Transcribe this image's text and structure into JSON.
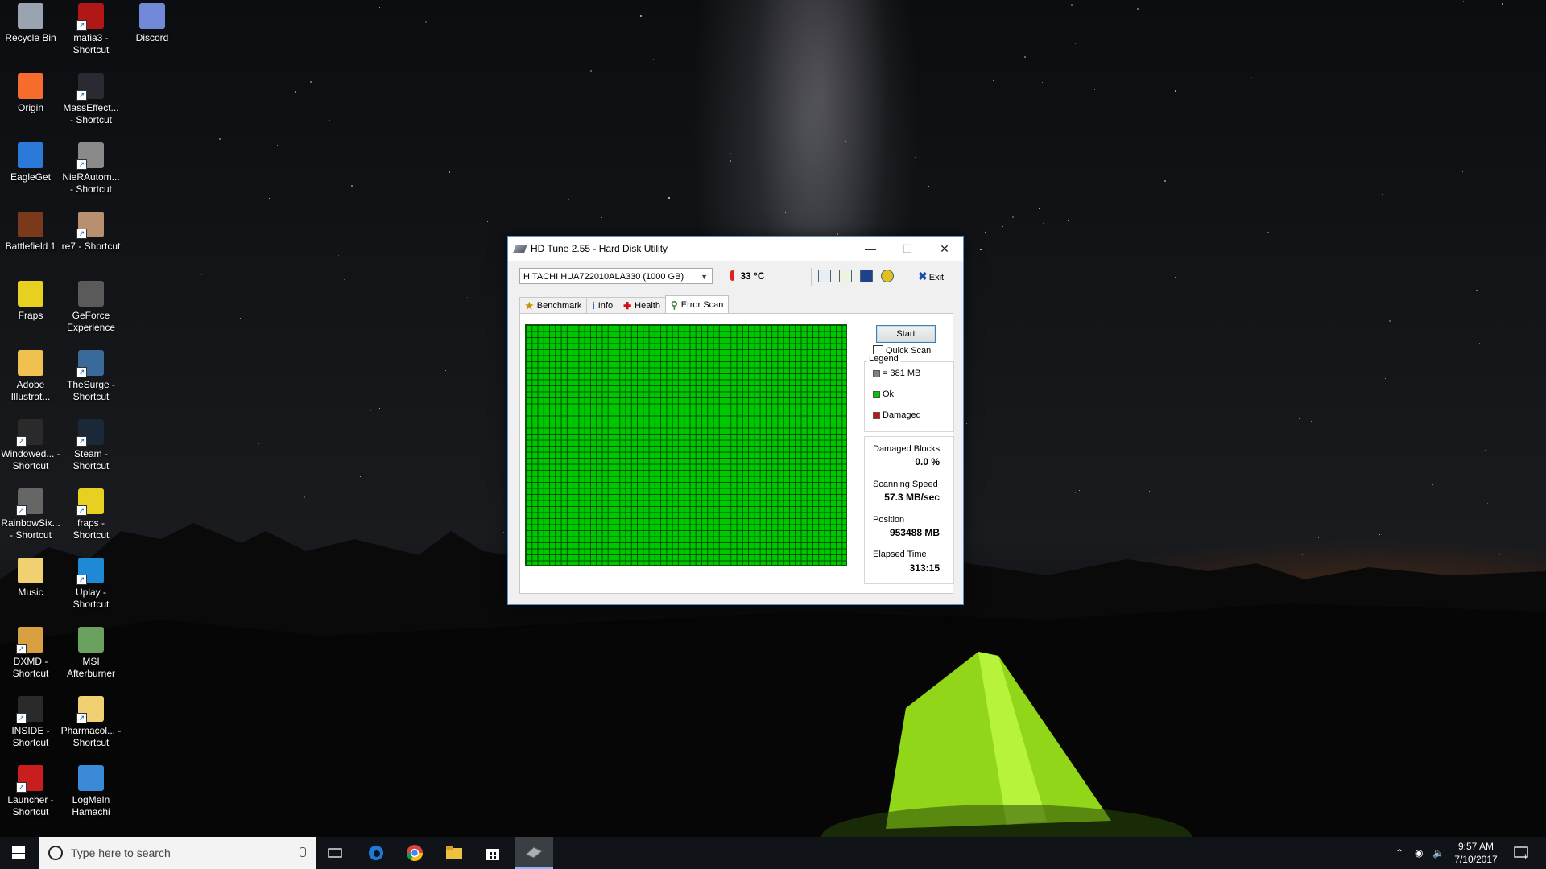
{
  "desktop_icons": [
    {
      "label": "Recycle Bin",
      "icon": "recycle-bin-icon",
      "color": "#9aa4b0"
    },
    {
      "label": "mafia3 - Shortcut",
      "icon": "mafia3-icon",
      "color": "#b01818"
    },
    {
      "label": "Discord",
      "icon": "discord-icon",
      "color": "#7289da"
    },
    {
      "label": "Origin",
      "icon": "origin-icon",
      "color": "#f56c2d"
    },
    {
      "label": "MassEffect... - Shortcut",
      "icon": "masseffect-icon",
      "color": "#2a2a32"
    },
    {
      "label": "EagleGet",
      "icon": "eagleget-icon",
      "color": "#2b79d8"
    },
    {
      "label": "NieRAutom... - Shortcut",
      "icon": "nier-icon",
      "color": "#8a8a8a"
    },
    {
      "label": "Battlefield 1",
      "icon": "battlefield-icon",
      "color": "#7a3a1a"
    },
    {
      "label": "re7 - Shortcut",
      "icon": "re7-icon",
      "color": "#b89070"
    },
    {
      "label": "Fraps",
      "icon": "fraps-icon",
      "color": "#e8d020"
    },
    {
      "label": "GeForce Experience",
      "icon": "geforce-icon",
      "color": "#5a5a5a"
    },
    {
      "label": "Adobe Illustrat...",
      "icon": "illustrator-icon",
      "color": "#f0c050"
    },
    {
      "label": "TheSurge - Shortcut",
      "icon": "thesurge-icon",
      "color": "#3a6a9a"
    },
    {
      "label": "Windowed... - Shortcut",
      "icon": "windowed-icon",
      "color": "#2a2a2a"
    },
    {
      "label": "Steam - Shortcut",
      "icon": "steam-icon",
      "color": "#1b2838"
    },
    {
      "label": "RainbowSix... - Shortcut",
      "icon": "rainbowsix-icon",
      "color": "#666666"
    },
    {
      "label": "fraps - Shortcut",
      "icon": "fraps-shortcut-icon",
      "color": "#e8d020"
    },
    {
      "label": "Music",
      "icon": "music-folder-icon",
      "color": "#f0d070"
    },
    {
      "label": "Uplay - Shortcut",
      "icon": "uplay-icon",
      "color": "#1e8ad6"
    },
    {
      "label": "DXMD - Shortcut",
      "icon": "dxmd-icon",
      "color": "#d8a040"
    },
    {
      "label": "MSI Afterburner",
      "icon": "afterburner-icon",
      "color": "#6aa060"
    },
    {
      "label": "INSIDE - Shortcut",
      "icon": "inside-icon",
      "color": "#2a2a2a"
    },
    {
      "label": "Pharmacol... - Shortcut",
      "icon": "folder-icon",
      "color": "#f0d070"
    },
    {
      "label": "Launcher - Shortcut",
      "icon": "hitman-launcher-icon",
      "color": "#c81e1e"
    },
    {
      "label": "LogMeIn Hamachi",
      "icon": "hamachi-icon",
      "color": "#3a8ad8"
    }
  ],
  "window": {
    "title": "HD Tune 2.55 - Hard Disk Utility",
    "drive_select": "HITACHI HUA722010ALA330 (1000 GB)",
    "temperature": "33 °C",
    "exit_label": "Exit",
    "tabs": [
      {
        "label": "Benchmark",
        "icon": "benchmark-icon"
      },
      {
        "label": "Info",
        "icon": "info-icon"
      },
      {
        "label": "Health",
        "icon": "health-icon"
      },
      {
        "label": "Error Scan",
        "icon": "error-scan-icon"
      }
    ],
    "active_tab": "Error Scan",
    "start_button": "Start",
    "quick_scan_label": "Quick Scan",
    "quick_scan_checked": false,
    "legend_title": "Legend",
    "legend": [
      {
        "label": "= 381 MB",
        "color": "#808080"
      },
      {
        "label": "Ok",
        "color": "#00c800"
      },
      {
        "label": "Damaged",
        "color": "#d01010"
      }
    ],
    "stats": {
      "damaged_blocks_label": "Damaged Blocks",
      "damaged_blocks_value": "0.0 %",
      "scanning_speed_label": "Scanning Speed",
      "scanning_speed_value": "57.3 MB/sec",
      "position_label": "Position",
      "position_value": "953488 MB",
      "elapsed_label": "Elapsed Time",
      "elapsed_value": "313:15"
    },
    "grid_color": "#00c800"
  },
  "taskbar": {
    "search_placeholder": "Type here to search",
    "apps": [
      "task-view-icon",
      "edge-icon",
      "chrome-icon",
      "file-explorer-icon",
      "store-icon",
      "hdtune-icon"
    ],
    "time": "9:57 AM",
    "date": "7/10/2017",
    "notification_count": "1"
  }
}
